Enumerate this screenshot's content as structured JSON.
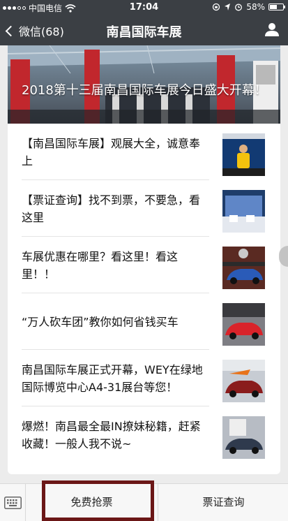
{
  "status_bar": {
    "carrier": "中国电信",
    "time": "17:04",
    "battery": "58%",
    "battery_level": 0.58
  },
  "nav": {
    "back_label": "微信(68)",
    "title": "南昌国际车展"
  },
  "hero": {
    "headline": "2018第十三届南昌国际车展今日盛大开幕！"
  },
  "articles": [
    {
      "title": "【南昌国际车展】观展大全，诚意奉上"
    },
    {
      "title": "【票证查询】找不到票，不要急，看这里"
    },
    {
      "title": "车展优惠在哪里？看这里！看这里！！"
    },
    {
      "title": "“万人砍车团”教你如何省钱买车"
    },
    {
      "title": "南昌国际车展正式开幕，WEY在绿地国际博览中心A4-31展台等您！"
    },
    {
      "title": "爆燃！南昌最全最IN撩妹秘籍，赶紧收藏！一般人我不说~"
    }
  ],
  "bottom_menu": {
    "button_1": "免费抢票",
    "button_2": "票证查询"
  },
  "colors": {
    "bar": "#3b3f44",
    "highlight_border": "#6b1717"
  }
}
